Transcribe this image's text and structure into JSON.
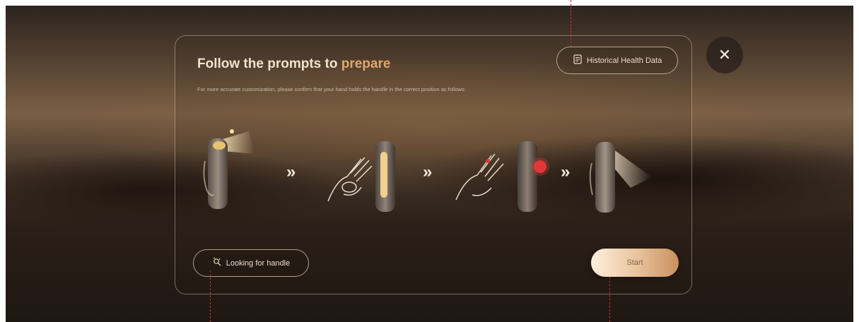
{
  "dialog": {
    "title_part1": "Follow the ",
    "title_part2": "prompts to ",
    "title_part3": "prepare",
    "subtitle": "For more accurate customization, please confirm that your hand holds the handle in the correct position as follows:"
  },
  "buttons": {
    "history_label": "Historical Health Data",
    "looking_label": "Looking for handle",
    "start_label": "Start",
    "close_glyph": "✕"
  },
  "steps": {
    "arrow_glyph": "»",
    "count": 4
  },
  "colors": {
    "accent": "#e0a86c",
    "title": "#f1e3cc",
    "indicator_red": "#e03838",
    "annotation_red": "#d0342c"
  }
}
